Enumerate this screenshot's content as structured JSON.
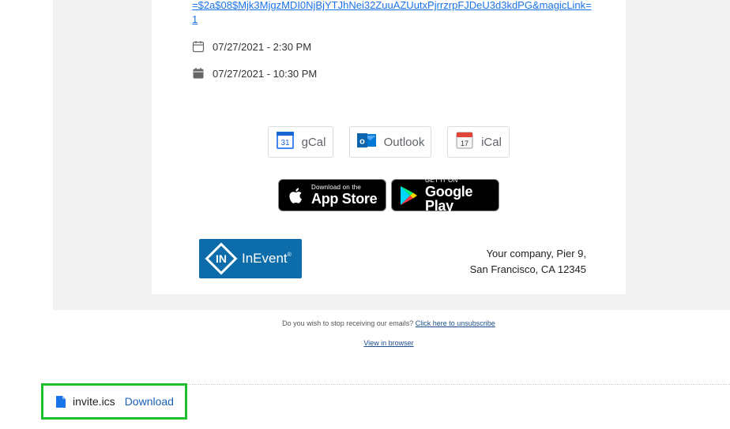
{
  "email": {
    "magic_link": "=$2a$08$Mjk3MjgzMDI0NjBjYTJhNei32ZuuAZUutxPjrrzrpFJDeU3d3kdPG&magicLink=1",
    "start_datetime": "07/27/2021 - 2:30 PM",
    "end_datetime": "07/27/2021 - 10:30 PM",
    "calendar_buttons": [
      {
        "label": "gCal",
        "icon": "google-calendar-icon",
        "icon_text": "31"
      },
      {
        "label": "Outlook",
        "icon": "outlook-icon",
        "icon_text": "o"
      },
      {
        "label": "iCal",
        "icon": "ical-icon",
        "icon_text": "17"
      }
    ],
    "app_store": {
      "small": "Download on the",
      "big": "App Store"
    },
    "google_play": {
      "small": "GET IT ON",
      "big": "Google Play"
    },
    "logo_text": "InEvent",
    "logo_mark": "IN",
    "address_line1": "Your company, Pier 9,",
    "address_line2": "San Francisco, CA 12345",
    "unsubscribe_text": "Do you wish to stop receiving our emails?",
    "unsubscribe_link": "Click here to unsubscribe",
    "view_in_browser": "View in browser"
  },
  "attachment": {
    "filename": "invite.ics",
    "download_label": "Download",
    "icon": "file-icon",
    "highlight_color": "#1fbf2e"
  },
  "colors": {
    "link": "#1a73e8",
    "logo_bg": "#0d6dab"
  }
}
